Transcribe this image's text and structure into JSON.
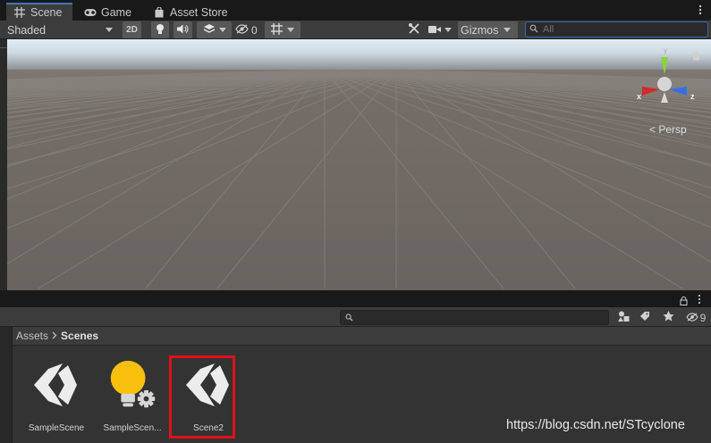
{
  "tabs": [
    {
      "label": "Scene",
      "icon": "grid-icon",
      "active": true
    },
    {
      "label": "Game",
      "icon": "gamepad-icon",
      "active": false
    },
    {
      "label": "Asset Store",
      "icon": "shopping-bag-icon",
      "active": false
    }
  ],
  "scene_toolbar": {
    "draw_mode": "Shaded",
    "mode_2d": "2D",
    "hidden_count": "0",
    "gizmos_label": "Gizmos",
    "search_placeholder": "All"
  },
  "viewport": {
    "projection_label": "Persp",
    "axes": {
      "x": "x",
      "y": "y",
      "z": "z"
    },
    "colors": {
      "sky_top": "#dfe7f0",
      "horizon": "#8e9299",
      "ground": "#6e6760",
      "x_axis": "#db2a2a",
      "y_axis": "#8bd534",
      "z_axis": "#3a6ee8"
    }
  },
  "project": {
    "hidden_count": "9",
    "breadcrumb": {
      "root": "Assets",
      "current": "Scenes"
    },
    "assets": [
      {
        "label": "SampleScene",
        "icon": "unity-scene-icon"
      },
      {
        "label": "SampleScen...",
        "icon": "lighting-settings-icon"
      },
      {
        "label": "Scene2",
        "icon": "unity-scene-icon",
        "highlighted": true
      }
    ]
  },
  "watermark": "https://blog.csdn.net/STcyclone"
}
